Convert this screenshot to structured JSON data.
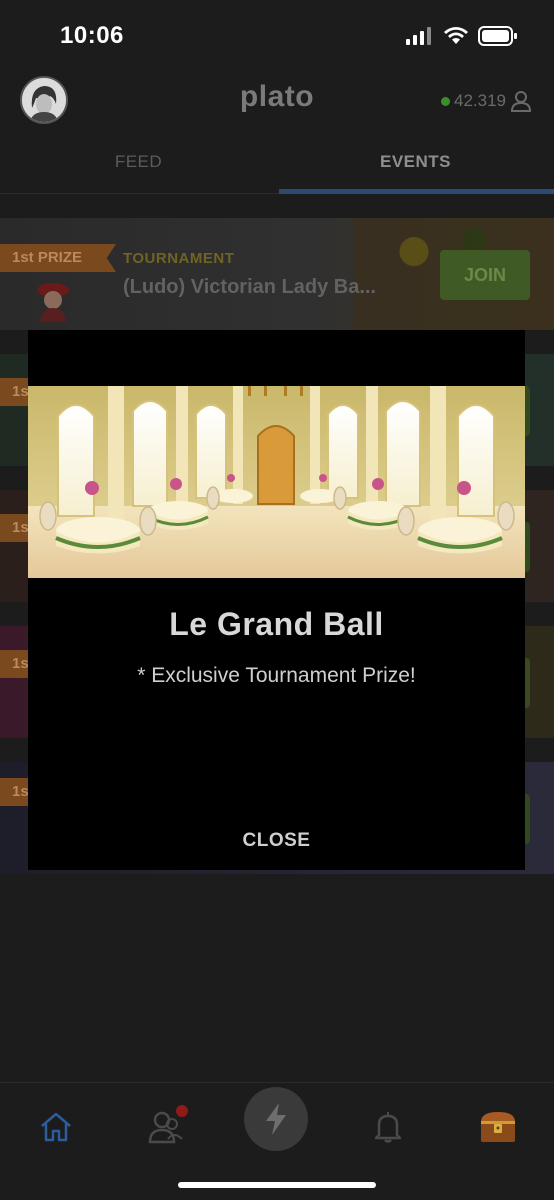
{
  "status": {
    "time": "10:06"
  },
  "header": {
    "logo": "plato",
    "coins": "42.319"
  },
  "tabs": [
    {
      "label": "FEED",
      "active": false
    },
    {
      "label": "EVENTS",
      "active": true
    }
  ],
  "events": [
    {
      "prize_label": "1st PRIZE",
      "type": "TOURNAMENT",
      "title": "(Ludo) Victorian Lady Ba...",
      "action": "JOIN"
    }
  ],
  "partial_events": [
    {
      "prize_label": "1s"
    },
    {
      "prize_label": "1s"
    },
    {
      "prize_label": "1s"
    },
    {
      "prize_label": "1s"
    }
  ],
  "modal": {
    "title": "Le Grand Ball",
    "subtitle": "* Exclusive Tournament Prize!",
    "close_label": "CLOSE"
  },
  "bottom_nav": {
    "items": [
      "home-icon",
      "friends-icon",
      "lightning-icon",
      "bell-icon",
      "treasure-chest-icon"
    ],
    "active": "home-icon"
  },
  "colors": {
    "background": "#1c1c1c",
    "accent_blue": "#2c4a74",
    "join_green": "#3f5a24",
    "prize_brown": "#7a4a1e",
    "notification_red": "#8e1a1a"
  }
}
